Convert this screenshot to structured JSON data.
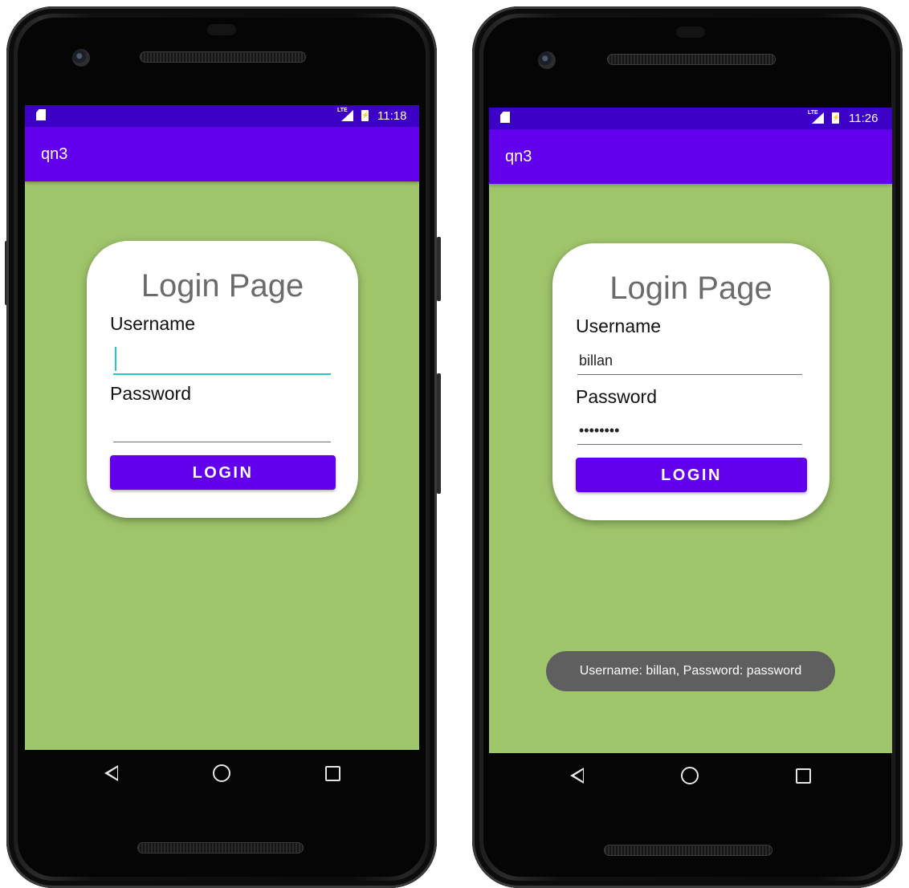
{
  "left": {
    "status": {
      "time": "11:18"
    },
    "appbar": {
      "title": "qn3"
    },
    "card": {
      "heading": "Login Page",
      "username_label": "Username",
      "username_value": "",
      "password_label": "Password",
      "password_value": "",
      "login_button": "LOGIN"
    }
  },
  "right": {
    "status": {
      "time": "11:26"
    },
    "appbar": {
      "title": "qn3"
    },
    "card": {
      "heading": "Login Page",
      "username_label": "Username",
      "username_value": "billan",
      "password_label": "Password",
      "password_value": "••••••••",
      "login_button": "LOGIN"
    },
    "toast": "Username: billan, Password: password"
  },
  "icons": {
    "status": [
      "sd-card-icon",
      "lte-signal-icon",
      "battery-charging-icon"
    ],
    "nav": [
      "back-icon",
      "home-icon",
      "recents-icon"
    ]
  },
  "colors": {
    "status_bar": "#3c00c6",
    "app_bar": "#6200ee",
    "background": "#9fc56b",
    "button": "#6200ee",
    "focus_accent": "#26c6c6",
    "toast": "#5f5f5f"
  }
}
